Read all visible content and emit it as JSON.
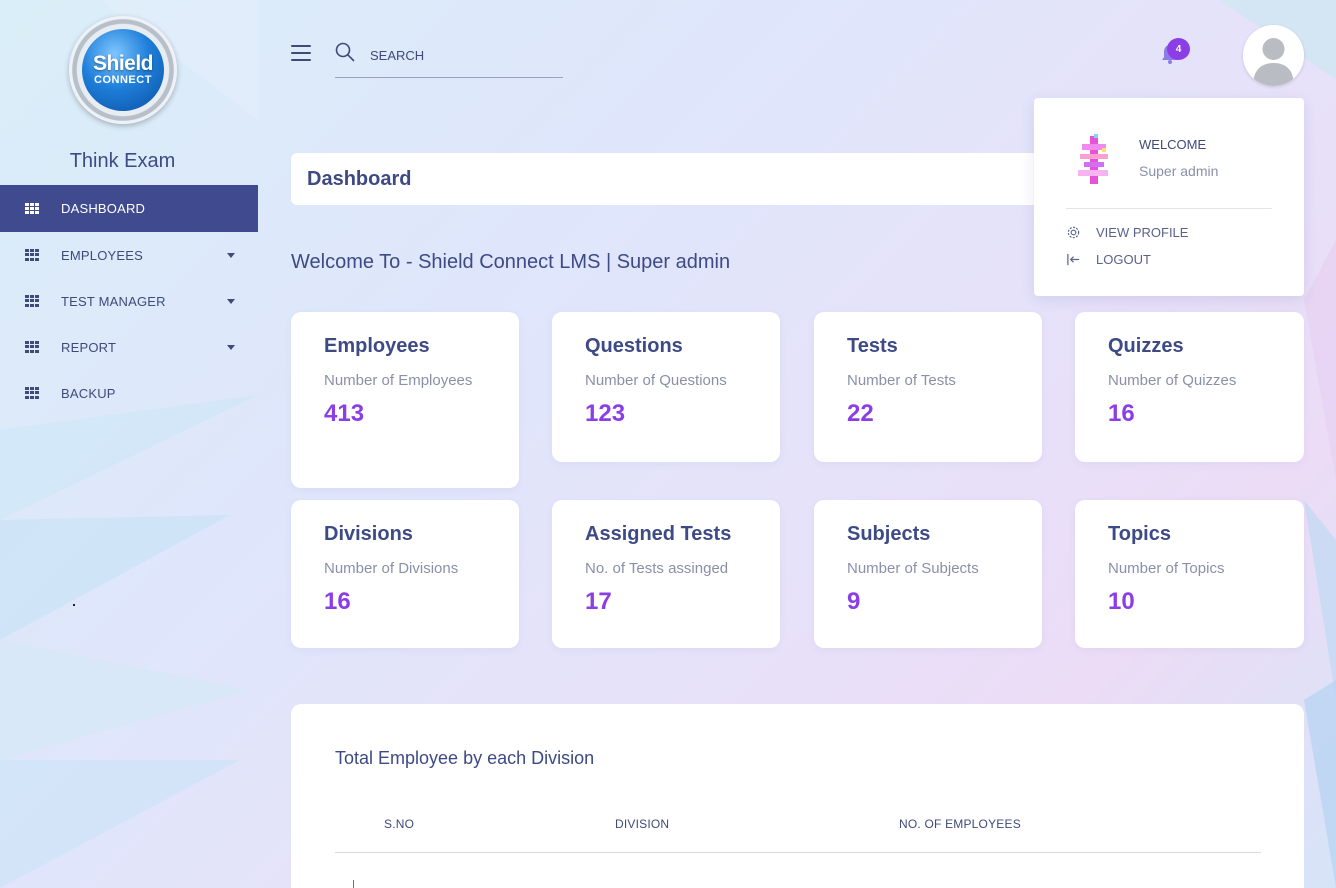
{
  "brand": {
    "logo_line1": "Shield",
    "logo_line2": "CONNECT",
    "app_name": "Think Exam"
  },
  "sidebar": {
    "items": [
      {
        "label": "DASHBOARD",
        "active": true,
        "has_caret": false
      },
      {
        "label": "EMPLOYEES",
        "active": false,
        "has_caret": true
      },
      {
        "label": "TEST MANAGER",
        "active": false,
        "has_caret": true
      },
      {
        "label": "REPORT",
        "active": false,
        "has_caret": true
      },
      {
        "label": "BACKUP",
        "active": false,
        "has_caret": false
      }
    ]
  },
  "topbar": {
    "search_placeholder": "SEARCH",
    "notification_count": "4",
    "icons": [
      "menu-icon",
      "search-icon",
      "bell-icon",
      "user-avatar"
    ]
  },
  "profile_menu": {
    "welcome": "WELCOME",
    "user_name": "Super admin",
    "view_profile": "VIEW PROFILE",
    "logout": "LOGOUT"
  },
  "page": {
    "title": "Dashboard",
    "welcome_message": "Welcome To - Shield Connect LMS | Super admin"
  },
  "cards": [
    {
      "title": "Employees",
      "subtitle": "Number of Employees",
      "value": "413"
    },
    {
      "title": "Questions",
      "subtitle": "Number of Questions",
      "value": "123"
    },
    {
      "title": "Tests",
      "subtitle": "Number of Tests",
      "value": "22"
    },
    {
      "title": "Quizzes",
      "subtitle": "Number of Quizzes",
      "value": "16"
    },
    {
      "title": "Divisions",
      "subtitle": "Number of Divisions",
      "value": "16"
    },
    {
      "title": "Assigned Tests",
      "subtitle": "No. of Tests assinged",
      "value": "17"
    },
    {
      "title": "Subjects",
      "subtitle": "Number of Subjects",
      "value": "9"
    },
    {
      "title": "Topics",
      "subtitle": "Number of Topics",
      "value": "10"
    }
  ],
  "division_table": {
    "title": "Total Employee by each Division",
    "columns": [
      "S.NO",
      "DIVISION",
      "NO. OF EMPLOYEES"
    ]
  },
  "colors": {
    "primary": "#3f4a8f",
    "accent": "#8b3ee6",
    "text": "#3d4a85",
    "muted": "#8a90a8"
  }
}
